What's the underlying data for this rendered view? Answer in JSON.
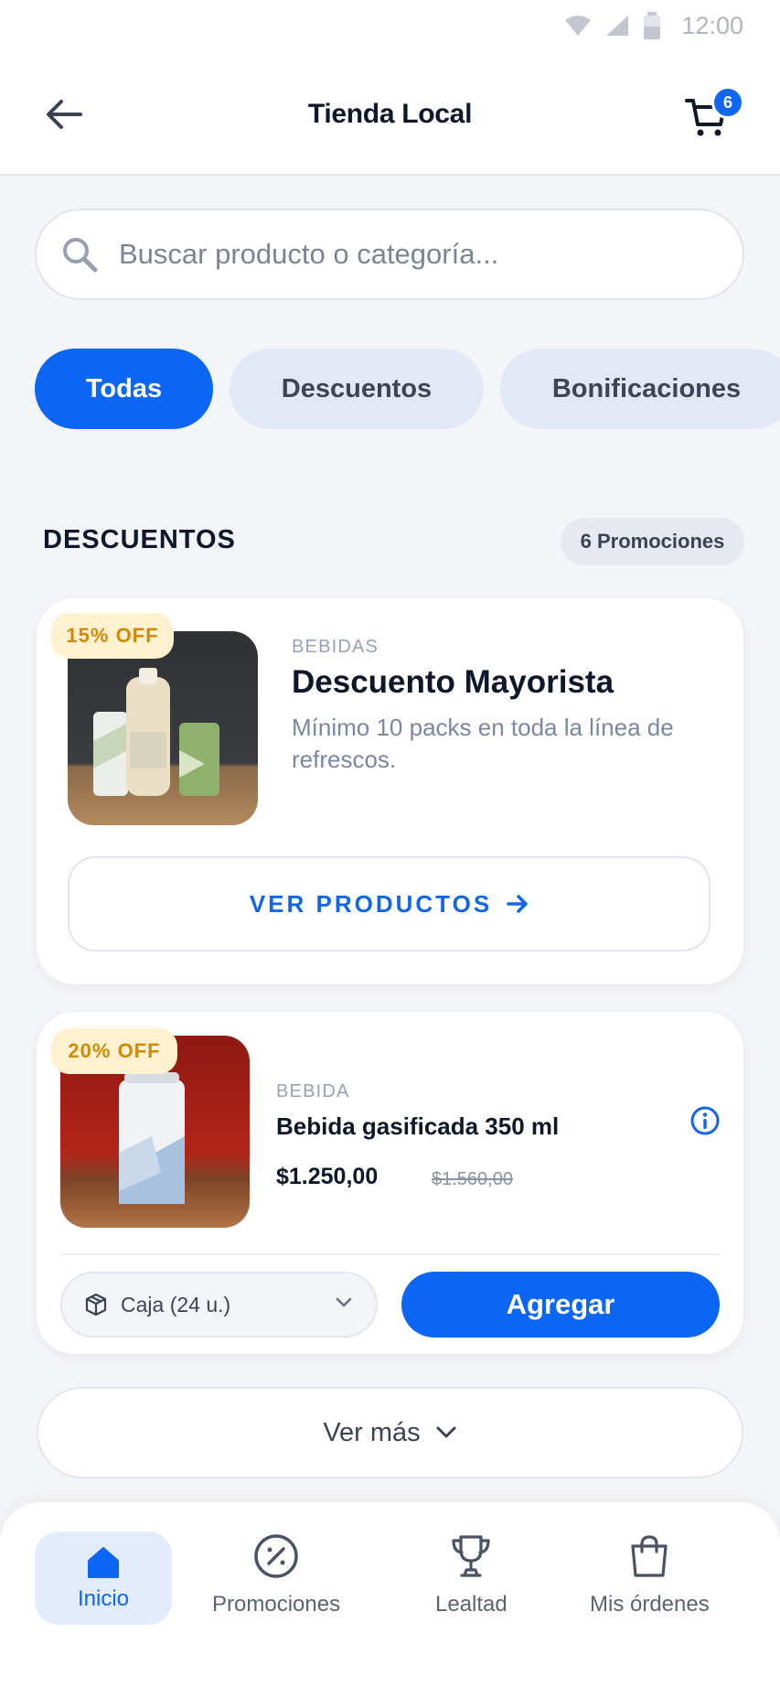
{
  "status_bar": {
    "time": "12:00"
  },
  "header": {
    "title": "Tienda Local",
    "cart_count": "6"
  },
  "search": {
    "placeholder": "Buscar producto o categoría..."
  },
  "filters": [
    {
      "label": "Todas",
      "active": true
    },
    {
      "label": "Descuentos",
      "active": false
    },
    {
      "label": "Bonificaciones",
      "active": false
    }
  ],
  "section": {
    "title": "DESCUENTOS",
    "count_label": "6 Promociones"
  },
  "promo_card": {
    "badge": "15% OFF",
    "category": "BEBIDAS",
    "title": "Descuento Mayorista",
    "description": "Mínimo 10 packs en toda la línea de refrescos.",
    "button_label": "VER PRODUCTOS"
  },
  "product_card": {
    "badge": "20% OFF",
    "category": "BEBIDA",
    "title": "Bebida gasificada 350 ml",
    "price": "$1.250,00",
    "old_price": "$1.560,00",
    "unit_option": "Caja (24 u.)",
    "add_label": "Agregar"
  },
  "load_more": {
    "label": "Ver más"
  },
  "bottom_nav": {
    "items": [
      {
        "label": "Inicio",
        "icon": "home-icon",
        "active": true
      },
      {
        "label": "Promociones",
        "icon": "discount-icon",
        "active": false
      },
      {
        "label": "Lealtad",
        "icon": "trophy-icon",
        "active": false
      },
      {
        "label": "Mis órdenes",
        "icon": "shopping-bag-icon",
        "active": false
      }
    ]
  },
  "colors": {
    "primary": "#0b66f5",
    "badge_bg": "#fdf1cf",
    "badge_text": "#d08a08",
    "chip_inactive": "#e2e8f5"
  }
}
